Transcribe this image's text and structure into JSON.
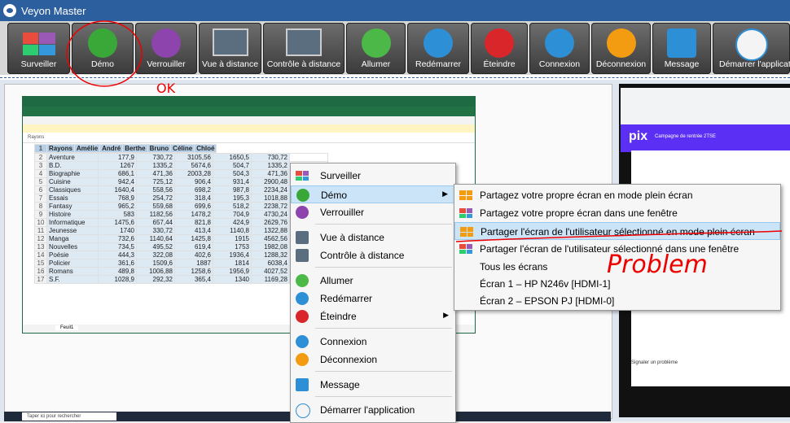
{
  "window": {
    "title": "Veyon Master"
  },
  "toolbar": {
    "buttons": [
      {
        "label": "Surveiller",
        "icon": "monitor-grid-icon"
      },
      {
        "label": "Démo",
        "icon": "presentation-icon"
      },
      {
        "label": "Verrouiller",
        "icon": "lock-icon"
      },
      {
        "label": "Vue à distance",
        "icon": "remote-view-icon"
      },
      {
        "label": "Contrôle à distance",
        "icon": "remote-control-icon"
      },
      {
        "label": "Allumer",
        "icon": "power-on-icon"
      },
      {
        "label": "Redémarrer",
        "icon": "restart-icon"
      },
      {
        "label": "Éteindre",
        "icon": "power-off-icon"
      },
      {
        "label": "Connexion",
        "icon": "login-icon"
      },
      {
        "label": "Déconnexion",
        "icon": "logout-icon"
      },
      {
        "label": "Message",
        "icon": "message-icon"
      },
      {
        "label": "Démarrer l'application",
        "icon": "start-app-icon"
      }
    ]
  },
  "excel": {
    "formula_value": "Rayons",
    "sheet_tab": "Feuil1",
    "headers": [
      "Rayons",
      "Amélie",
      "André",
      "Berthe",
      "Bruno",
      "Céline",
      "Chloé"
    ],
    "rows": [
      [
        "Aventure",
        "177,9",
        "730,72",
        "3105,56",
        "1650,5",
        "730,72"
      ],
      [
        "B.D.",
        "1267",
        "1335,2",
        "5674,6",
        "504,7",
        "1335,2"
      ],
      [
        "Biographie",
        "686,1",
        "471,36",
        "2003,28",
        "504,3",
        "471,36"
      ],
      [
        "Cuisine",
        "942,4",
        "725,12",
        "906,4",
        "931,4",
        "2900,48"
      ],
      [
        "Classiques",
        "1640,4",
        "558,56",
        "698,2",
        "987,8",
        "2234,24"
      ],
      [
        "Essais",
        "768,9",
        "254,72",
        "318,4",
        "195,3",
        "1018,88"
      ],
      [
        "Fantasy",
        "965,2",
        "559,68",
        "699,6",
        "518,2",
        "2238,72"
      ],
      [
        "Histoire",
        "583",
        "1182,56",
        "1478,2",
        "704,9",
        "4730,24"
      ],
      [
        "Informatique",
        "1475,6",
        "657,44",
        "821,8",
        "424,9",
        "2629,76"
      ],
      [
        "Jeunesse",
        "1740",
        "330,72",
        "413,4",
        "1140,8",
        "1322,88"
      ],
      [
        "Manga",
        "732,6",
        "1140,64",
        "1425,8",
        "1915",
        "4562,56"
      ],
      [
        "Nouvelles",
        "734,5",
        "495,52",
        "619,4",
        "1753",
        "1982,08"
      ],
      [
        "Poésie",
        "444,3",
        "322,08",
        "402,6",
        "1936,4",
        "1288,32"
      ],
      [
        "Policier",
        "361,6",
        "1509,6",
        "1887",
        "1814",
        "6038,4"
      ],
      [
        "Romans",
        "489,8",
        "1006,88",
        "1258,6",
        "1956,9",
        "4027,52"
      ],
      [
        "S.F.",
        "1028,9",
        "292,32",
        "365,4",
        "1340",
        "1169,28"
      ]
    ]
  },
  "taskbar": {
    "search_placeholder": "Taper ici pour rechercher"
  },
  "pix": {
    "logo": "pix",
    "campaign": "Campagne de rentrée 2TSE",
    "signal": "Signaler un problème"
  },
  "context_menu": {
    "items": [
      {
        "label": "Surveiller",
        "icon": "monitor-grid-icon"
      },
      {
        "label": "Démo",
        "icon": "presentation-icon",
        "active": true,
        "submenu": true
      },
      {
        "label": "Verrouiller",
        "icon": "lock-icon"
      },
      {
        "label": "Vue à distance",
        "icon": "remote-view-icon"
      },
      {
        "label": "Contrôle à distance",
        "icon": "remote-control-icon"
      },
      {
        "label": "Allumer",
        "icon": "power-on-icon"
      },
      {
        "label": "Redémarrer",
        "icon": "restart-icon"
      },
      {
        "label": "Éteindre",
        "icon": "power-off-icon",
        "submenu": true
      },
      {
        "label": "Connexion",
        "icon": "login-icon"
      },
      {
        "label": "Déconnexion",
        "icon": "logout-icon"
      },
      {
        "label": "Message",
        "icon": "message-icon"
      },
      {
        "label": "Démarrer l'application",
        "icon": "start-app-icon"
      }
    ]
  },
  "demo_submenu": {
    "items": [
      {
        "label": "Partagez votre propre écran en mode plein écran",
        "icon": "share-fullscreen-icon"
      },
      {
        "label": "Partagez votre propre écran dans une fenêtre",
        "icon": "share-window-icon"
      },
      {
        "label": "Partager l'écran de l'utilisateur sélectionné en mode plein écran",
        "icon": "share-user-fullscreen-icon",
        "active": true
      },
      {
        "label": "Partager l'écran de l'utilisateur sélectionné dans une fenêtre",
        "icon": "share-user-window-icon"
      },
      {
        "label": "Tous les écrans"
      },
      {
        "label": "Écran 1 – HP N246v [HDMI-1]"
      },
      {
        "label": "Écran 2 – EPSON PJ [HDMI-0]"
      }
    ]
  },
  "annotations": {
    "ok": "OK",
    "problem": "Problem"
  },
  "colors": {
    "titlebar": "#2c5f9e",
    "menu_active": "#cce4f7",
    "annotation": "#e00000"
  }
}
